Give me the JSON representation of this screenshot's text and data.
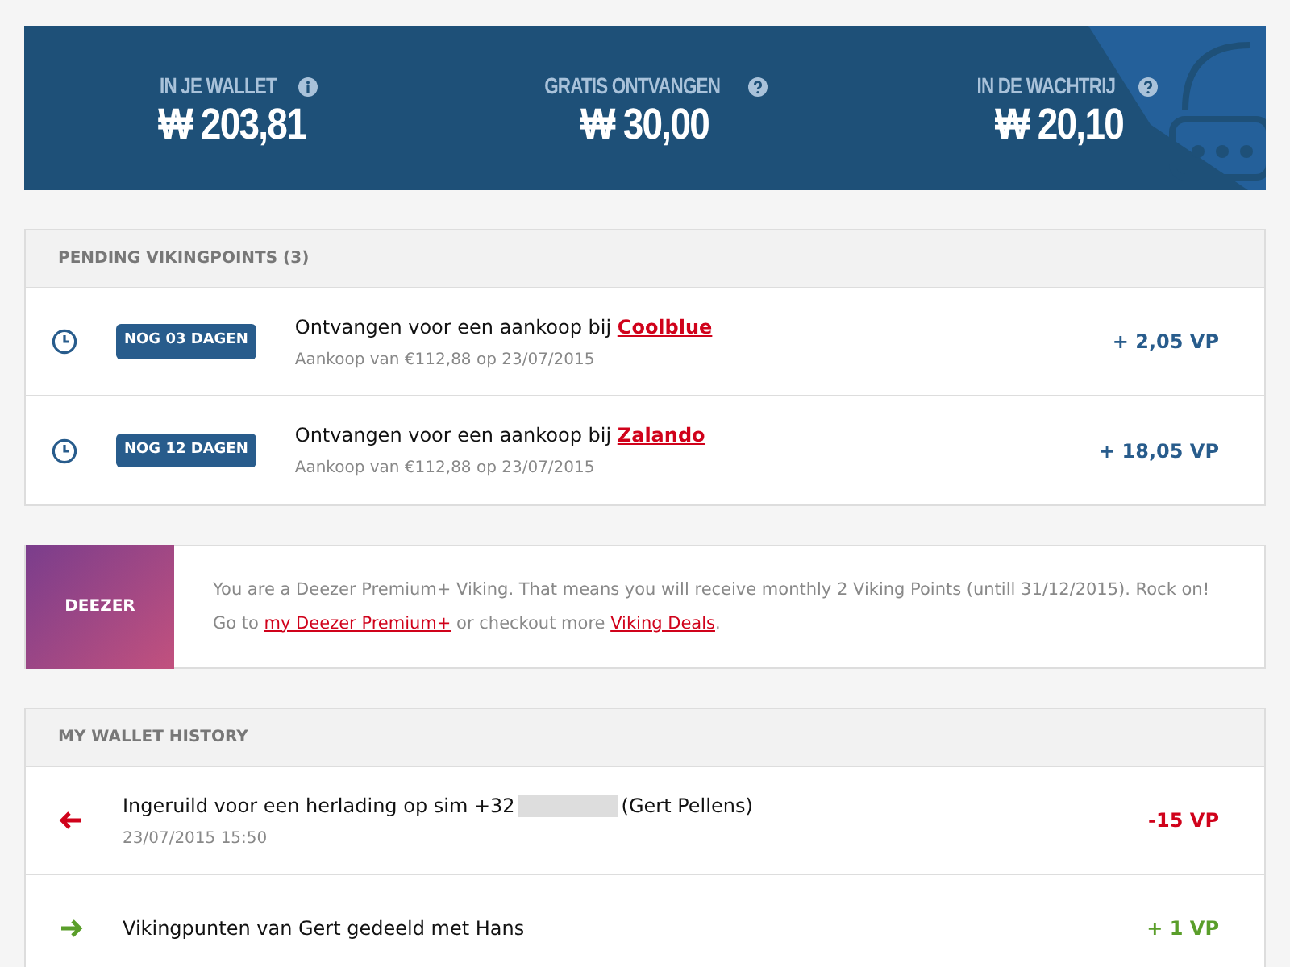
{
  "summary": [
    {
      "label": "IN JE WALLET",
      "value": "₩ 203,81"
    },
    {
      "label": "GRATIS ONTVANGEN",
      "value": "₩ 30,00"
    },
    {
      "label": "IN DE WACHTRIJ",
      "value": "₩ 20,10"
    }
  ],
  "pending": {
    "title": "PENDING VIKINGPOINTS (3)",
    "items": [
      {
        "badge": "NOG 03 DAGEN",
        "text": "Ontvangen voor een aankoop bij ",
        "link": "Coolblue",
        "sub": "Aankoop van €112,88 op 23/07/2015",
        "amount": "+ 2,05 VP"
      },
      {
        "badge": "NOG 12 DAGEN",
        "text": "Ontvangen voor een aankoop bij ",
        "link": "Zalando",
        "sub": "Aankoop van €112,88 op 23/07/2015",
        "amount": "+ 18,05 VP"
      }
    ]
  },
  "promo": {
    "logo": "DEEZER",
    "line1": "You are a Deezer Premium+ Viking. That means you will receive monthly 2 Viking Points (untill 31/12/2015). Rock on!",
    "line2": [
      {
        "text": "Go to "
      },
      {
        "link": "my Deezer Premium+"
      },
      {
        "text": " or checkout more "
      },
      {
        "link": "Viking Deals"
      },
      {
        "text": "."
      }
    ]
  },
  "history": {
    "title": "MY WALLET HISTORY",
    "items": [
      {
        "kind": "out",
        "before": "Ingeruild voor een herlading op sim +32",
        "redacted": true,
        "after": "(Gert Pellens)",
        "date": "23/07/2015  15:50",
        "amount": "-15 VP"
      },
      {
        "kind": "in",
        "before": "Vikingpunten van Gert gedeeld met Hans",
        "redacted": false,
        "amount": "+ 1 VP"
      }
    ]
  }
}
